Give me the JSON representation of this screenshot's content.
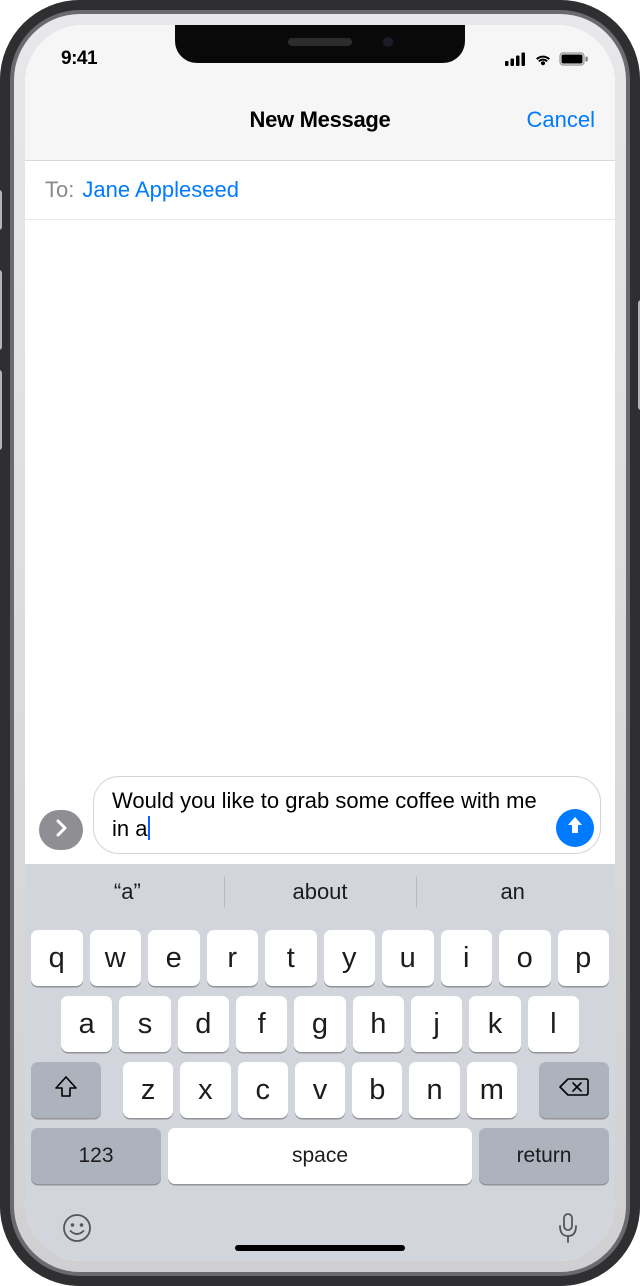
{
  "statusbar": {
    "time": "9:41"
  },
  "nav": {
    "title": "New Message",
    "cancel": "Cancel"
  },
  "to": {
    "label": "To:",
    "recipient": "Jane Appleseed"
  },
  "compose": {
    "text": "Would you like to grab some coffee with me in a"
  },
  "suggestions": {
    "s0": "“a”",
    "s1": "about",
    "s2": "an"
  },
  "keys": {
    "r1": {
      "0": "q",
      "1": "w",
      "2": "e",
      "3": "r",
      "4": "t",
      "5": "y",
      "6": "u",
      "7": "i",
      "8": "o",
      "9": "p"
    },
    "r2": {
      "0": "a",
      "1": "s",
      "2": "d",
      "3": "f",
      "4": "g",
      "5": "h",
      "6": "j",
      "7": "k",
      "8": "l"
    },
    "r3": {
      "0": "z",
      "1": "x",
      "2": "c",
      "3": "v",
      "4": "b",
      "5": "n",
      "6": "m"
    },
    "num": "123",
    "space": "space",
    "return": "return"
  }
}
